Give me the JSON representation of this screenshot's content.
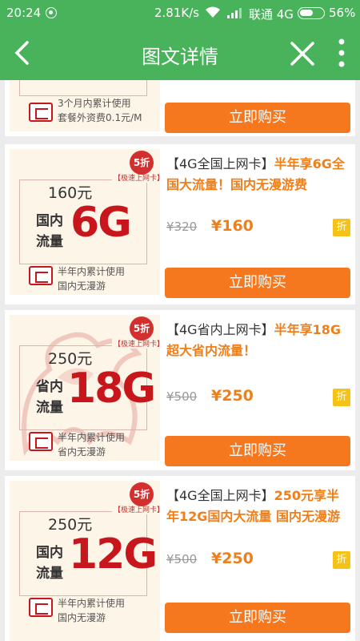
{
  "status": {
    "time": "20:24",
    "speed": "2.81K/s",
    "carrier": "联通 4G",
    "battery": "56%"
  },
  "header": {
    "title": "图文详情"
  },
  "top_card": {
    "note_line1": "3个月内累计使用",
    "note_line2": "套餐外资费0.1元/M",
    "buy_label": "立即购买"
  },
  "products": [
    {
      "badge": "5折",
      "tag": "【极速上网卡】",
      "price_text": "160元",
      "scope_line1": "国内",
      "scope_line2": "流量",
      "gb": "6G",
      "note_line1": "半年内累计使用",
      "note_line2": "国内无漫游",
      "title_bracket": "【4G全国上网卡】",
      "title_highlight": "半年享6G全国大流量！国内无漫游费",
      "old_price": "¥320",
      "new_price": "¥160",
      "discount_icon": "折",
      "buy_label": "立即购买"
    },
    {
      "badge": "5折",
      "tag": "【极速上网卡】",
      "price_text": "250元",
      "scope_line1": "省内",
      "scope_line2": "流量",
      "gb": "18G",
      "note_line1": "半年内累计使用",
      "note_line2": "省内无漫游",
      "title_bracket": "【4G省内上网卡】",
      "title_highlight": "半年享18G超大省内流量！",
      "old_price": "¥500",
      "new_price": "¥250",
      "discount_icon": "折",
      "buy_label": "立即购买"
    },
    {
      "badge": "5折",
      "tag": "【极速上网卡】",
      "price_text": "250元",
      "scope_line1": "国内",
      "scope_line2": "流量",
      "gb": "12G",
      "note_line1": "半年内累计使用",
      "note_line2": "国内无漫游",
      "title_bracket": "【4G全国上网卡】",
      "title_highlight": "250元享半年12G国内大流量 国内无漫游",
      "old_price": "¥500",
      "new_price": "¥250",
      "discount_icon": "折",
      "buy_label": "立即购买"
    }
  ],
  "colors": {
    "header_green": "#49b35c",
    "buy_orange": "#f5781f",
    "price_orange": "#f07f1a",
    "gb_red": "#c8161d",
    "discount_yellow": "#f5c318"
  }
}
